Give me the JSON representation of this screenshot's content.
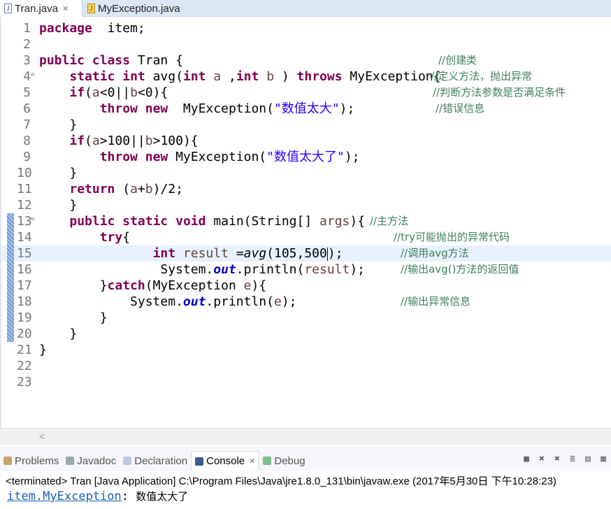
{
  "editor_tabs": [
    {
      "label": "Tran.java",
      "active": true,
      "icon": "java-file-icon"
    },
    {
      "label": "MyException.java",
      "active": false,
      "icon": "java-file-icon"
    }
  ],
  "editor": {
    "current_line": 15,
    "changed_lines": [
      13,
      14,
      15,
      16,
      17,
      18,
      19,
      20
    ],
    "folded_lines": [
      4,
      13
    ],
    "lines": [
      {
        "n": "1",
        "tokens": [
          [
            "kw",
            "package"
          ],
          [
            "",
            "  item;"
          ]
        ]
      },
      {
        "n": "2",
        "tokens": []
      },
      {
        "n": "3",
        "tokens": [
          [
            "kw",
            "public"
          ],
          [
            "",
            " "
          ],
          [
            "kw",
            "class"
          ],
          [
            "",
            " Tran {"
          ]
        ],
        "comment": "//创建类"
      },
      {
        "n": "4",
        "tokens": [
          [
            "",
            "    "
          ],
          [
            "kw",
            "static"
          ],
          [
            "",
            " "
          ],
          [
            "kw",
            "int"
          ],
          [
            "",
            " avg("
          ],
          [
            "kw",
            "int"
          ],
          [
            "",
            " "
          ],
          [
            "par",
            "a"
          ],
          [
            "",
            " ,"
          ],
          [
            "kw",
            "int"
          ],
          [
            "",
            " "
          ],
          [
            "par",
            "b"
          ],
          [
            "",
            " ) "
          ],
          [
            "kw",
            "throws"
          ],
          [
            "",
            " MyException{"
          ]
        ],
        "comment": "//定义方法，抛出异常"
      },
      {
        "n": "5",
        "tokens": [
          [
            "",
            "    "
          ],
          [
            "kw",
            "if"
          ],
          [
            "",
            "("
          ],
          [
            "par",
            "a"
          ],
          [
            "",
            "<0||"
          ],
          [
            "par",
            "b"
          ],
          [
            "",
            "<0){"
          ]
        ],
        "comment": "//判断方法参数是否满足条件"
      },
      {
        "n": "6",
        "tokens": [
          [
            "",
            "        "
          ],
          [
            "kw",
            "throw"
          ],
          [
            "",
            " "
          ],
          [
            "kw",
            "new"
          ],
          [
            "",
            "  MyException("
          ],
          [
            "str",
            "\"数值太大\""
          ],
          [
            "",
            ");"
          ]
        ],
        "comment": "//错误信息"
      },
      {
        "n": "7",
        "tokens": [
          [
            "",
            "    }"
          ]
        ]
      },
      {
        "n": "8",
        "tokens": [
          [
            "",
            "    "
          ],
          [
            "kw",
            "if"
          ],
          [
            "",
            "("
          ],
          [
            "par",
            "a"
          ],
          [
            "",
            ">100||"
          ],
          [
            "par",
            "b"
          ],
          [
            "",
            ">100){"
          ]
        ]
      },
      {
        "n": "9",
        "tokens": [
          [
            "",
            "        "
          ],
          [
            "kw",
            "throw"
          ],
          [
            "",
            " "
          ],
          [
            "kw",
            "new"
          ],
          [
            "",
            " MyException("
          ],
          [
            "str",
            "\"数值太大了\""
          ],
          [
            "",
            ");"
          ]
        ]
      },
      {
        "n": "10",
        "tokens": [
          [
            "",
            "    }"
          ]
        ]
      },
      {
        "n": "11",
        "tokens": [
          [
            "",
            "    "
          ],
          [
            "kw",
            "return"
          ],
          [
            "",
            " ("
          ],
          [
            "par",
            "a"
          ],
          [
            "",
            "+"
          ],
          [
            "par",
            "b"
          ],
          [
            "",
            ")/2;"
          ]
        ]
      },
      {
        "n": "12",
        "tokens": [
          [
            "",
            "    }"
          ]
        ]
      },
      {
        "n": "13",
        "tokens": [
          [
            "",
            "    "
          ],
          [
            "kw",
            "public"
          ],
          [
            "",
            " "
          ],
          [
            "kw",
            "static"
          ],
          [
            "",
            " "
          ],
          [
            "kw",
            "void"
          ],
          [
            "",
            " main(String[] "
          ],
          [
            "par",
            "args"
          ],
          [
            "",
            "){"
          ]
        ],
        "comment": "//主方法"
      },
      {
        "n": "14",
        "tokens": [
          [
            "",
            "        "
          ],
          [
            "kw",
            "try"
          ],
          [
            "",
            "{"
          ]
        ],
        "comment": "//try可能抛出的异常代码"
      },
      {
        "n": "15",
        "tokens": [
          [
            "",
            "               "
          ],
          [
            "kw",
            "int"
          ],
          [
            "",
            " "
          ],
          [
            "par",
            "result"
          ],
          [
            "",
            " ="
          ],
          [
            "ital",
            "avg"
          ],
          [
            "",
            "(105,500"
          ],
          [
            "cursor",
            ""
          ],
          [
            "",
            ");"
          ]
        ],
        "comment": "//调用avg方法"
      },
      {
        "n": "16",
        "tokens": [
          [
            "",
            "                System."
          ],
          [
            "fld",
            "out"
          ],
          [
            "",
            ".println("
          ],
          [
            "par",
            "result"
          ],
          [
            "",
            ");"
          ]
        ],
        "comment": "//输出avg()方法的返回值"
      },
      {
        "n": "17",
        "tokens": [
          [
            "",
            "        }"
          ],
          [
            "kw",
            "catch"
          ],
          [
            "",
            "(MyException "
          ],
          [
            "par",
            "e"
          ],
          [
            "",
            "){"
          ]
        ]
      },
      {
        "n": "18",
        "tokens": [
          [
            "",
            "            System."
          ],
          [
            "fld",
            "out"
          ],
          [
            "",
            ".println("
          ],
          [
            "par",
            "e"
          ],
          [
            "",
            ");"
          ]
        ],
        "comment": "//输出异常信息"
      },
      {
        "n": "19",
        "tokens": [
          [
            "",
            "        }"
          ]
        ]
      },
      {
        "n": "20",
        "tokens": [
          [
            "",
            "    }"
          ]
        ]
      },
      {
        "n": "21",
        "tokens": [
          [
            "",
            "}"
          ]
        ]
      },
      {
        "n": "22",
        "tokens": []
      },
      {
        "n": "23",
        "tokens": []
      }
    ]
  },
  "scroll_left": "<",
  "panel_tabs": [
    {
      "label": "Problems",
      "icon": "problems-icon",
      "active": false
    },
    {
      "label": "Javadoc",
      "icon": "at-icon",
      "active": false
    },
    {
      "label": "Declaration",
      "icon": "declaration-icon",
      "active": false
    },
    {
      "label": "Console",
      "icon": "console-icon",
      "active": true
    },
    {
      "label": "Debug",
      "icon": "debug-icon",
      "active": false
    }
  ],
  "console": {
    "status": "<terminated> Tran [Java Application] C:\\Program Files\\Java\\jre1.8.0_131\\bin\\javaw.exe (2017年5月30日 下午10:28:23)",
    "output_link": "item.MyException",
    "output_sep": ": ",
    "output_msg": "数值太大了"
  },
  "colors": {
    "keyword": "#7f0055",
    "string": "#2a00ff",
    "comment": "#3f7f5f",
    "field": "#0000c0",
    "current_line": "#e8f2fe"
  }
}
